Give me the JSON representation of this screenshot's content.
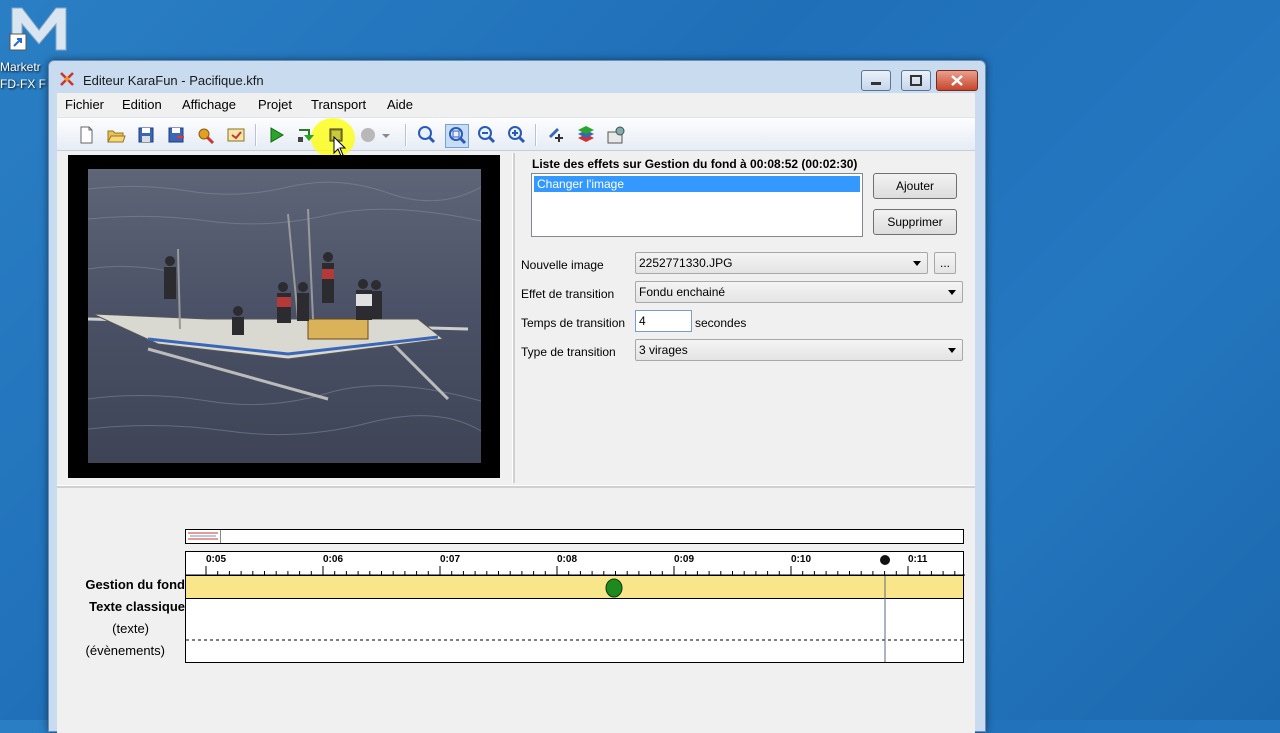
{
  "desktop": {
    "icon_label_1": "Marketr",
    "icon_label_2": "FD-FX F"
  },
  "window": {
    "title": "Editeur KaraFun - Pacifique.kfn"
  },
  "menu": [
    "Fichier",
    "Edition",
    "Affichage",
    "Projet",
    "Transport",
    "Aide"
  ],
  "toolbar": {
    "icons": [
      "new-file-icon",
      "open-folder-icon",
      "save-icon",
      "save-as-icon",
      "properties-icon",
      "export-icon",
      "play-icon",
      "play-loop-icon",
      "stop-icon",
      "record-icon",
      "record-dropdown-icon",
      "zoom-in-icon",
      "zoom-fit-icon",
      "zoom-out-icon",
      "zoom-reset-icon",
      "effects-icon",
      "layers-icon",
      "settings-icon"
    ]
  },
  "effects": {
    "header": "Liste des effets sur Gestion du fond à 00:08:52 (00:02:30)",
    "items": [
      "Changer l'image"
    ],
    "add_label": "Ajouter",
    "remove_label": "Supprimer"
  },
  "form": {
    "image_label": "Nouvelle image",
    "image_value": "2252771330.JPG",
    "browse_label": "...",
    "transition_effect_label": "Effet de transition",
    "transition_effect_value": "Fondu enchainé",
    "transition_time_label": "Temps de transition",
    "transition_time_value": "4",
    "seconds_label": "secondes",
    "transition_type_label": "Type de transition",
    "transition_type_value": "3 virages"
  },
  "timeline": {
    "ticks": [
      "0:05",
      "0:06",
      "0:07",
      "0:08",
      "0:09",
      "0:10",
      "0:11"
    ],
    "tracks": {
      "background": "Gestion du fond",
      "text": "Texte classique",
      "text_sub": "(texte)",
      "events_sub": "(évènements)"
    }
  },
  "colors": {
    "track_yellow": "#fae68a",
    "selection_blue": "#3399ff",
    "marker_green": "#1e8a1e",
    "highlight": "#ffff00"
  }
}
